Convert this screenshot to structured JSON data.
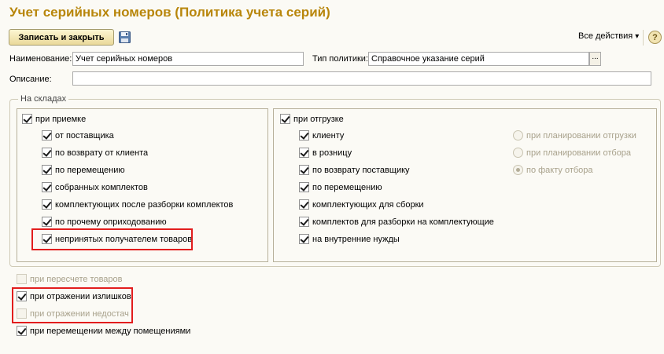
{
  "window": {
    "title": "Учет серийных номеров (Политика учета серий)"
  },
  "toolbar": {
    "save_close_label": "Записать и закрыть",
    "save_icon": "floppy-disk-icon",
    "all_actions_label": "Все действия",
    "all_actions_arrow": "▾",
    "help_label": "?"
  },
  "form": {
    "name_label": "Наименование:",
    "name_value": "Учет серийных номеров",
    "policy_type_label": "Тип политики:",
    "policy_type_value": "Справочное указание серий",
    "select_button": "...",
    "description_label": "Описание:",
    "description_value": ""
  },
  "warehouses": {
    "legend": "На складах",
    "receipt": {
      "label": "при приемке",
      "checked": true,
      "items": [
        {
          "label": "от поставщика",
          "checked": true
        },
        {
          "label": "по возврату от клиента",
          "checked": true
        },
        {
          "label": "по перемещению",
          "checked": true
        },
        {
          "label": "собранных комплектов",
          "checked": true
        },
        {
          "label": "комплектующих после разборки комплектов",
          "checked": true
        },
        {
          "label": "по прочему оприходованию",
          "checked": true
        },
        {
          "label": "непринятых получателем товаров",
          "checked": true
        }
      ]
    },
    "shipment": {
      "label": "при отгрузке",
      "checked": true,
      "items": [
        {
          "label": "клиенту",
          "checked": true
        },
        {
          "label": "в розницу",
          "checked": true
        },
        {
          "label": "по возврату поставщику",
          "checked": true
        },
        {
          "label": "по перемещению",
          "checked": true
        },
        {
          "label": "комплектующих для сборки",
          "checked": true
        },
        {
          "label": "комплектов для разборки на комплектующие",
          "checked": true
        },
        {
          "label": "на внутренние нужды",
          "checked": true
        }
      ],
      "radios": [
        {
          "label": "при планировании отгрузки",
          "checked": false
        },
        {
          "label": "при планировании отбора",
          "checked": false
        },
        {
          "label": "по факту отбора",
          "checked": true
        }
      ]
    }
  },
  "options": [
    {
      "label": "при пересчете товаров",
      "checked": false,
      "disabled": true
    },
    {
      "label": "при отражении излишков",
      "checked": true,
      "disabled": false
    },
    {
      "label": "при отражении недостач",
      "checked": false,
      "disabled": true
    },
    {
      "label": "при перемещении между помещениями",
      "checked": true,
      "disabled": false
    }
  ]
}
